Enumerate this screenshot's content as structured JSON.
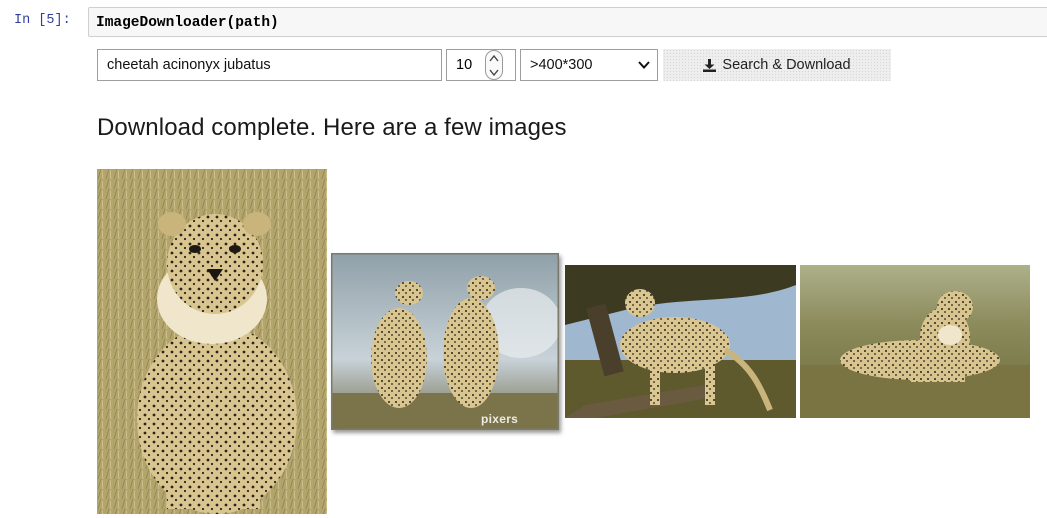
{
  "cell": {
    "prompt": "In [5]:",
    "code": "ImageDownloader(path)"
  },
  "widgets": {
    "search_value": "cheetah acinonyx jubatus",
    "count_value": "10",
    "size_selected": ">400*300",
    "button_label": "Search & Download",
    "button_icon": "download-icon"
  },
  "output": {
    "heading": "Download complete. Here are a few images",
    "images": [
      {
        "subject": "cheetah cub lying in grass",
        "watermark": ""
      },
      {
        "subject": "two cheetahs sitting, canvas print",
        "watermark": "pixers"
      },
      {
        "subject": "cheetah standing under tree",
        "watermark": ""
      },
      {
        "subject": "cheetah lying in savanna",
        "watermark": ""
      }
    ]
  },
  "colors": {
    "prompt": "#303f9f",
    "grass": "#b9aa72",
    "fur": "#d8c28a",
    "sky": "#9fb8d0"
  }
}
